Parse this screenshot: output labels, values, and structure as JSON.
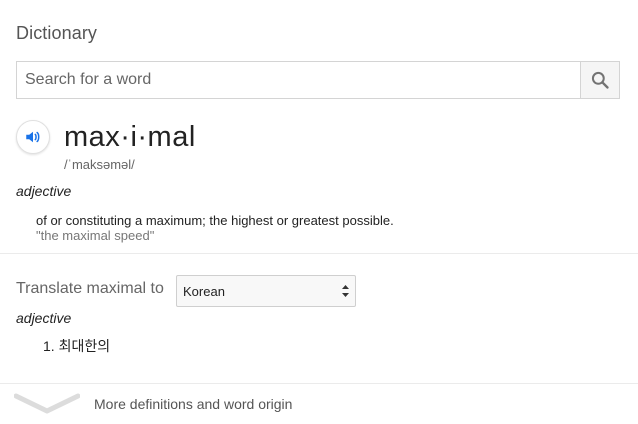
{
  "title": "Dictionary",
  "search": {
    "placeholder": "Search for a word",
    "value": ""
  },
  "entry": {
    "headword": "max·i·mal",
    "phonetic": "/ˈmaksəməl/",
    "part_of_speech": "adjective",
    "definition": "of or constituting a maximum; the highest or greatest possible.",
    "example": "\"the maximal speed\""
  },
  "translate": {
    "label": "Translate maximal to",
    "language": "Korean",
    "part_of_speech": "adjective",
    "items": [
      "1. 최대한의"
    ]
  },
  "footer": {
    "more_label": "More definitions and word origin"
  },
  "colors": {
    "accent": "#1a73e8",
    "icon_gray": "#737373"
  },
  "icons": {
    "search": "search-icon",
    "speaker": "speaker-icon",
    "expand": "chevron-down-icon",
    "select": "select-arrows-icon"
  }
}
